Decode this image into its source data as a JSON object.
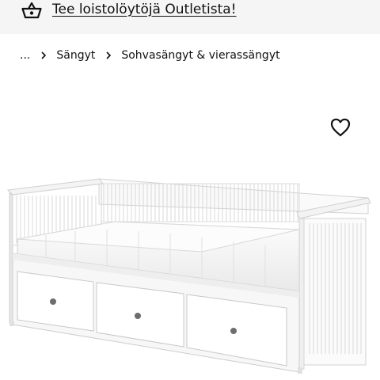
{
  "promo": {
    "text": "Tee loistolöytöjä Outletista!",
    "icon": "basket-icon"
  },
  "breadcrumb": {
    "ellipsis": "...",
    "items": [
      "Sängyt",
      "Sohvasängyt & vierassängyt"
    ]
  },
  "product": {
    "favourite_icon": "heart-icon",
    "image_subject": "white daybed with three drawers and mattress"
  },
  "colors": {
    "promo_background": "#f5f5f5",
    "text": "#111111",
    "page_background": "#ffffff"
  }
}
